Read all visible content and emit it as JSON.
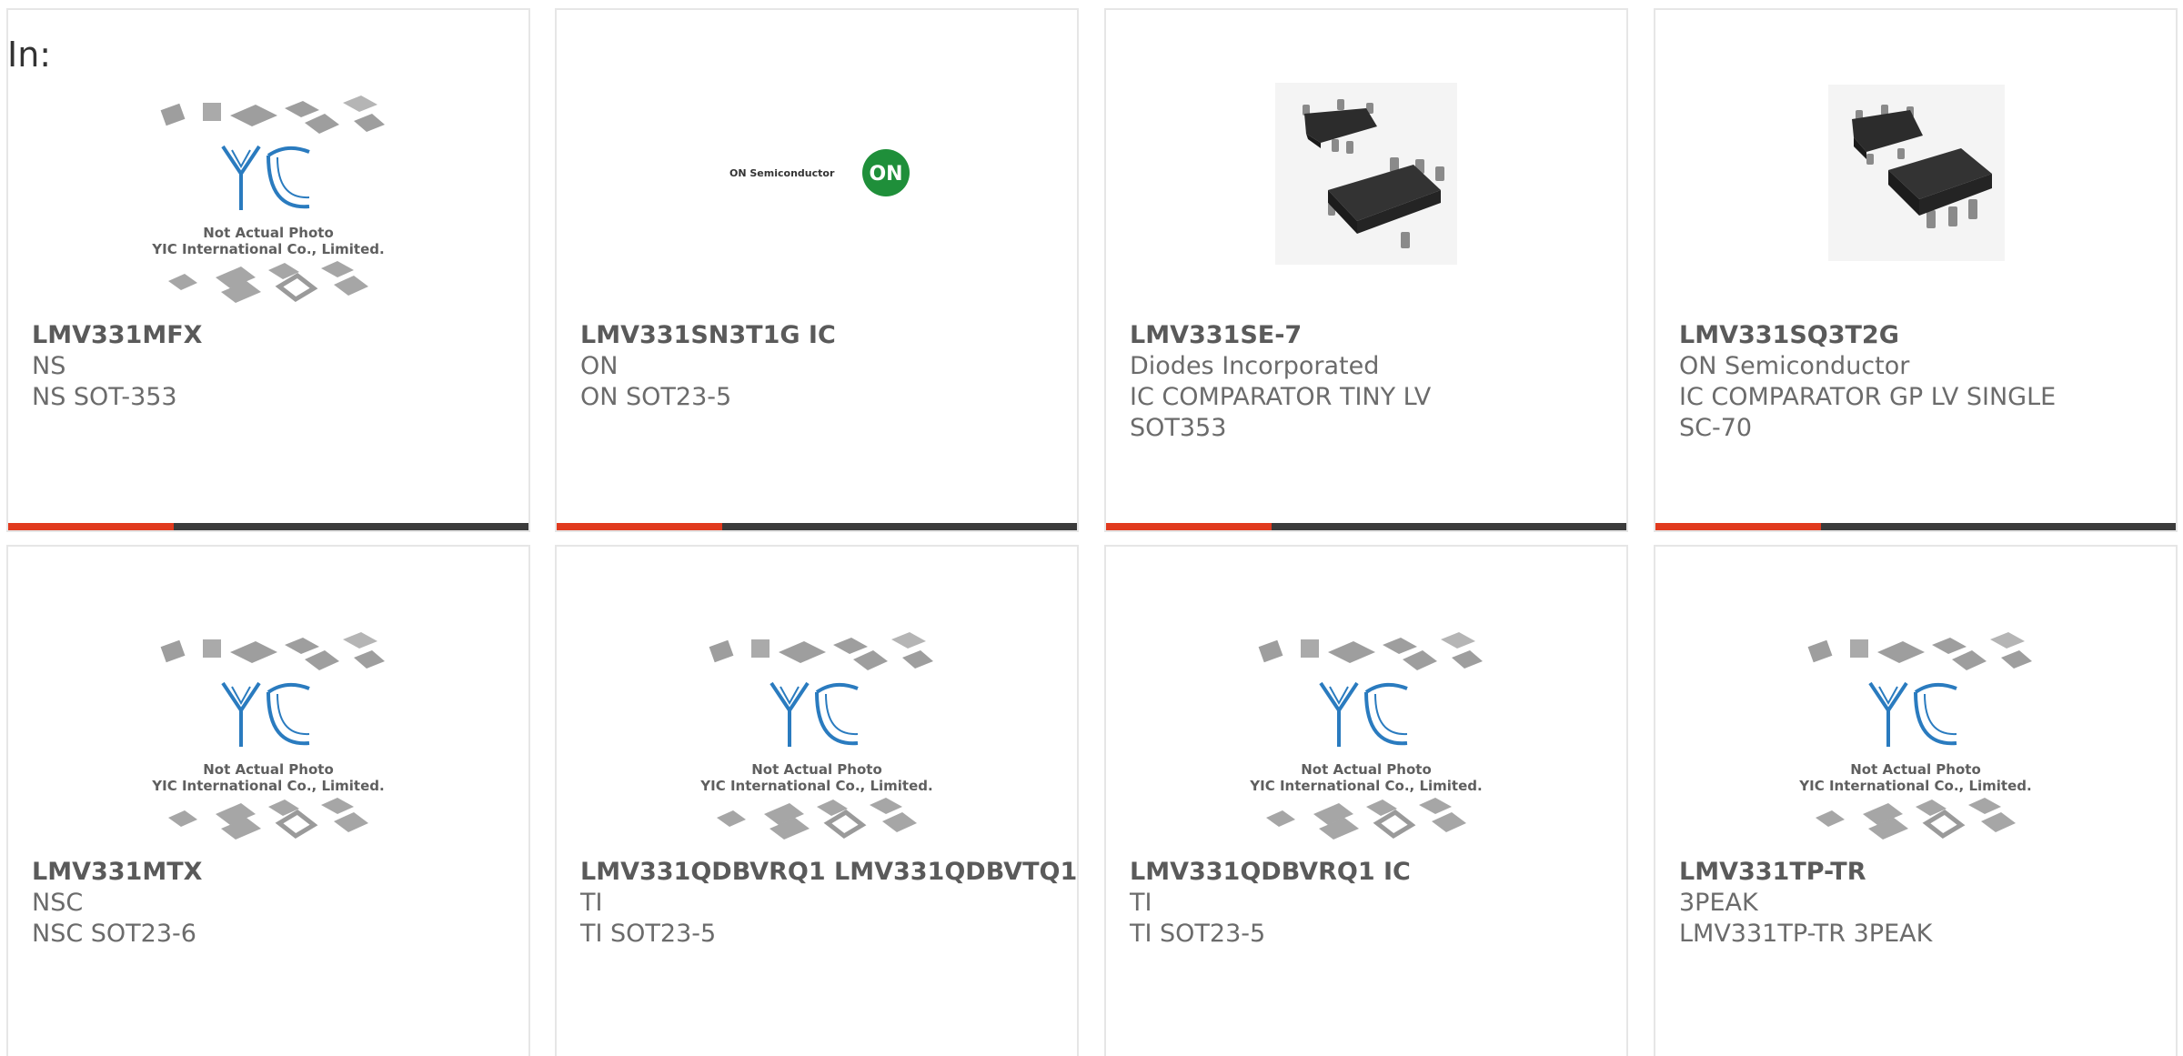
{
  "header": {
    "label": "In:"
  },
  "placeholder": {
    "line1": "Not Actual Photo",
    "line2": "YIC International Co., Limited.",
    "logo_text": "YIC"
  },
  "on_logo": {
    "wordmark": "ON Semiconductor",
    "badge": "ON"
  },
  "colors": {
    "accent": "#e13a1e",
    "bar_dark": "#3b3b3b",
    "yic_blue": "#2a7bbf",
    "on_green": "#1f8f3a",
    "text_gray": "#6b6b6b"
  },
  "products": [
    {
      "part": "LMV331MFX",
      "brand": "NS",
      "desc": "NS SOT-353",
      "image": "placeholder"
    },
    {
      "part": "LMV331SN3T1G IC",
      "brand": "ON",
      "desc": "ON SOT23-5",
      "image": "on-logo"
    },
    {
      "part": "LMV331SE-7",
      "brand": "Diodes Incorporated",
      "desc": "IC COMPARATOR TINY LV SOT353",
      "image": "chip-photo"
    },
    {
      "part": "LMV331SQ3T2G",
      "brand": "ON Semiconductor",
      "desc": "IC COMPARATOR GP LV SINGLE SC-70",
      "image": "chip-photo"
    },
    {
      "part": "LMV331MTX",
      "brand": "NSC",
      "desc": "NSC SOT23-6",
      "image": "placeholder"
    },
    {
      "part": "LMV331QDBVRQ1 LMV331QDBVTQ1",
      "brand": "TI",
      "desc": "TI SOT23-5",
      "image": "placeholder"
    },
    {
      "part": "LMV331QDBVRQ1 IC",
      "brand": "TI",
      "desc": "TI SOT23-5",
      "image": "placeholder"
    },
    {
      "part": "LMV331TP-TR",
      "brand": "3PEAK",
      "desc": "LMV331TP-TR 3PEAK",
      "image": "placeholder"
    }
  ]
}
